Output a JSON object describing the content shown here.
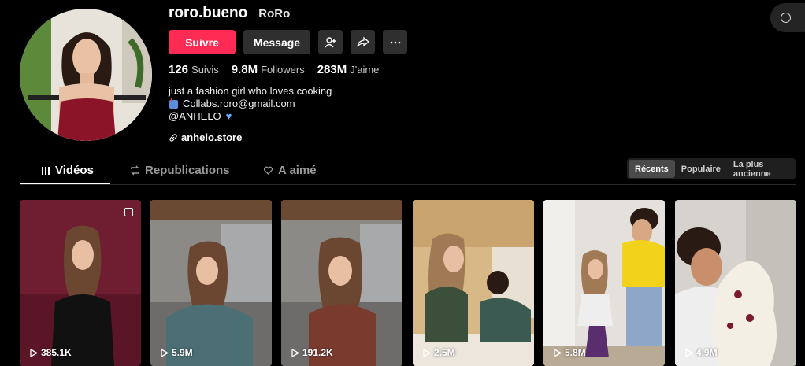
{
  "profile": {
    "username": "roro.bueno",
    "nickname": "RoRo"
  },
  "actions": {
    "follow_label": "Suivre",
    "message_label": "Message"
  },
  "stats": [
    {
      "value": "126",
      "label": "Suivis"
    },
    {
      "value": "9.8M",
      "label": "Followers"
    },
    {
      "value": "283M",
      "label": "J'aime"
    }
  ],
  "bio": {
    "line1": "just a fashion girl who loves cooking",
    "line2": "Collabs.roro@gmail.com",
    "line3": "@ANHELO",
    "link": "anhelo.store"
  },
  "tabs": [
    {
      "label": "Vidéos",
      "icon": "grid-icon"
    },
    {
      "label": "Republications",
      "icon": "repost-icon"
    },
    {
      "label": "A aimé",
      "icon": "heart-lock-icon"
    }
  ],
  "sort": {
    "options": [
      "Récents",
      "Populaire",
      "La plus ancienne"
    ],
    "selected": "Récents"
  },
  "videos": [
    {
      "views": "385.1K",
      "icon": "play-icon"
    },
    {
      "views": "5.9M",
      "icon": "play-icon"
    },
    {
      "views": "191.2K",
      "icon": "play-icon"
    },
    {
      "views": "2.5M",
      "icon": "play-icon"
    },
    {
      "views": "5.8M",
      "icon": "play-icon"
    },
    {
      "views": "4.9M",
      "icon": "play-icon"
    }
  ],
  "colors": {
    "accent": "#fe2c55",
    "background": "#000000",
    "button_secondary": "#2f2f2f"
  }
}
